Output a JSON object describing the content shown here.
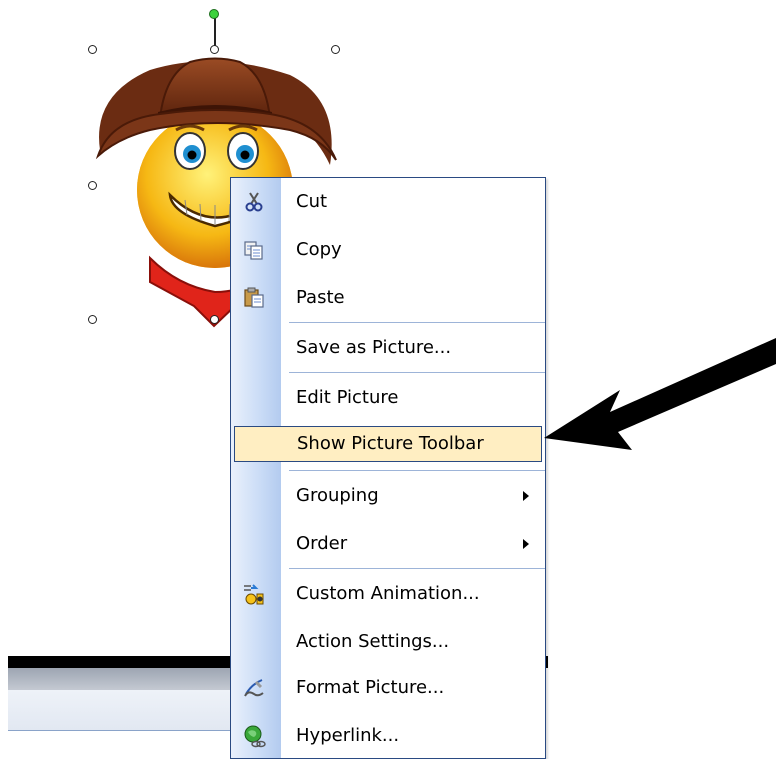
{
  "context_menu": {
    "items": [
      {
        "label": "Cut",
        "icon": "scissors-icon"
      },
      {
        "label": "Copy",
        "icon": "copy-icon"
      },
      {
        "label": "Paste",
        "icon": "paste-icon"
      },
      {
        "label": "Save as Picture...",
        "icon": ""
      },
      {
        "label": "Edit Picture",
        "icon": ""
      },
      {
        "label": "Show Picture Toolbar",
        "icon": "",
        "highlighted": true
      },
      {
        "label": "Grouping",
        "icon": "",
        "submenu": true
      },
      {
        "label": "Order",
        "icon": "",
        "submenu": true
      },
      {
        "label": "Custom Animation...",
        "icon": "custom-animation-icon"
      },
      {
        "label": "Action Settings...",
        "icon": ""
      },
      {
        "label": "Format Picture...",
        "icon": "format-picture-icon"
      },
      {
        "label": "Hyperlink...",
        "icon": "hyperlink-icon"
      }
    ]
  },
  "colors": {
    "menu_border": "#2a4a82",
    "highlight_fill": "#ffeec2",
    "gutter": "#c9dbf6",
    "rotation_handle": "#3cd23c"
  },
  "clip_art": {
    "subject": "cowboy smiley"
  }
}
